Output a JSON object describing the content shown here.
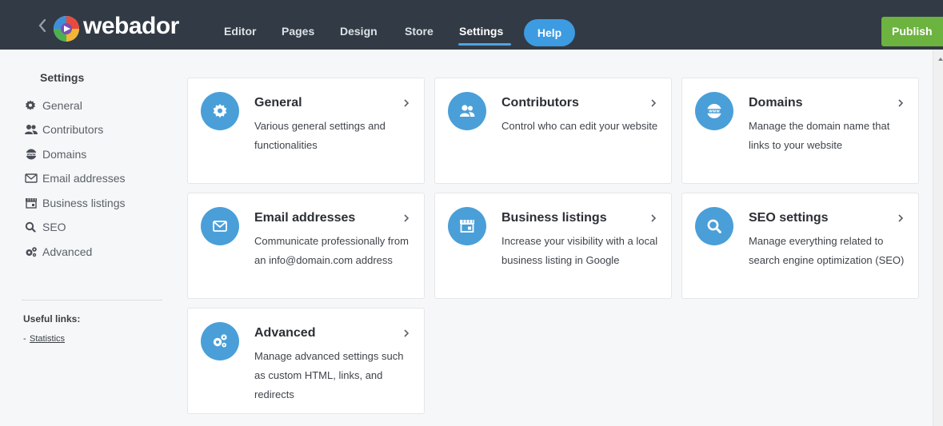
{
  "header": {
    "logo_text": "webador",
    "nav": [
      {
        "label": "Editor",
        "active": false
      },
      {
        "label": "Pages",
        "active": false
      },
      {
        "label": "Design",
        "active": false
      },
      {
        "label": "Store",
        "active": false
      },
      {
        "label": "Settings",
        "active": true
      }
    ],
    "help_label": "Help",
    "publish_label": "Publish"
  },
  "sidebar": {
    "title": "Settings",
    "items": [
      {
        "label": "General",
        "icon": "gear-icon"
      },
      {
        "label": "Contributors",
        "icon": "users-icon"
      },
      {
        "label": "Domains",
        "icon": "www-icon"
      },
      {
        "label": "Email addresses",
        "icon": "envelope-icon"
      },
      {
        "label": "Business listings",
        "icon": "storefront-icon"
      },
      {
        "label": "SEO",
        "icon": "search-icon"
      },
      {
        "label": "Advanced",
        "icon": "gears-icon"
      }
    ],
    "useful_links_title": "Useful links:",
    "useful_links": [
      {
        "prefix": "-",
        "label": "Statistics"
      }
    ]
  },
  "cards": [
    {
      "title": "General",
      "description": "Various general settings and functionalities",
      "icon": "gear-icon"
    },
    {
      "title": "Contributors",
      "description": "Control who can edit your website",
      "icon": "users-icon"
    },
    {
      "title": "Domains",
      "description": "Manage the domain name that links to your website",
      "icon": "www-icon"
    },
    {
      "title": "Email addresses",
      "description": "Communicate professionally from an info@domain.com address",
      "icon": "envelope-icon"
    },
    {
      "title": "Business listings",
      "description": "Increase your visibility with a local business listing in Google",
      "icon": "storefront-icon"
    },
    {
      "title": "SEO settings",
      "description": "Manage everything related to search engine optimization (SEO)",
      "icon": "search-icon"
    },
    {
      "title": "Advanced",
      "description": "Manage advanced settings such as custom HTML, links, and redirects",
      "icon": "gears-icon"
    }
  ],
  "colors": {
    "topbar": "#323a45",
    "accent_blue": "#4a9fd8",
    "help_blue": "#3d9be2",
    "publish_green": "#6cb33f",
    "page_bg": "#f6f7f8"
  }
}
